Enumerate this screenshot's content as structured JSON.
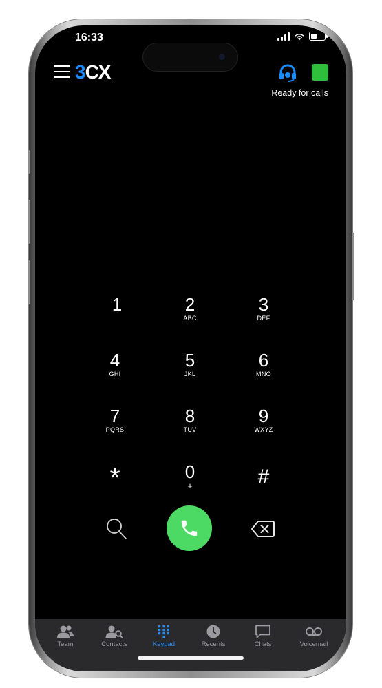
{
  "status_bar": {
    "time": "16:33"
  },
  "header": {
    "logo_main": "3",
    "logo_rest": "CX",
    "status_text": "Ready for calls",
    "status_color": "#2fbf3c",
    "accent": "#1a8cff"
  },
  "keypad": {
    "keys": [
      {
        "digit": "1",
        "letters": ""
      },
      {
        "digit": "2",
        "letters": "ABC"
      },
      {
        "digit": "3",
        "letters": "DEF"
      },
      {
        "digit": "4",
        "letters": "GHI"
      },
      {
        "digit": "5",
        "letters": "JKL"
      },
      {
        "digit": "6",
        "letters": "MNO"
      },
      {
        "digit": "7",
        "letters": "PQRS"
      },
      {
        "digit": "8",
        "letters": "TUV"
      },
      {
        "digit": "9",
        "letters": "WXYZ"
      },
      {
        "digit": "*",
        "letters": ""
      },
      {
        "digit": "0",
        "letters": "+"
      },
      {
        "digit": "#",
        "letters": ""
      }
    ],
    "call_color": "#4cd964"
  },
  "tabbar": {
    "tabs": [
      {
        "label": "Team",
        "icon": "team-icon"
      },
      {
        "label": "Contacts",
        "icon": "contacts-icon"
      },
      {
        "label": "Keypad",
        "icon": "keypad-icon",
        "active": true
      },
      {
        "label": "Recents",
        "icon": "clock-icon"
      },
      {
        "label": "Chats",
        "icon": "chat-icon"
      },
      {
        "label": "Voicemail",
        "icon": "voicemail-icon"
      }
    ],
    "active_color": "#2b8cf0"
  }
}
